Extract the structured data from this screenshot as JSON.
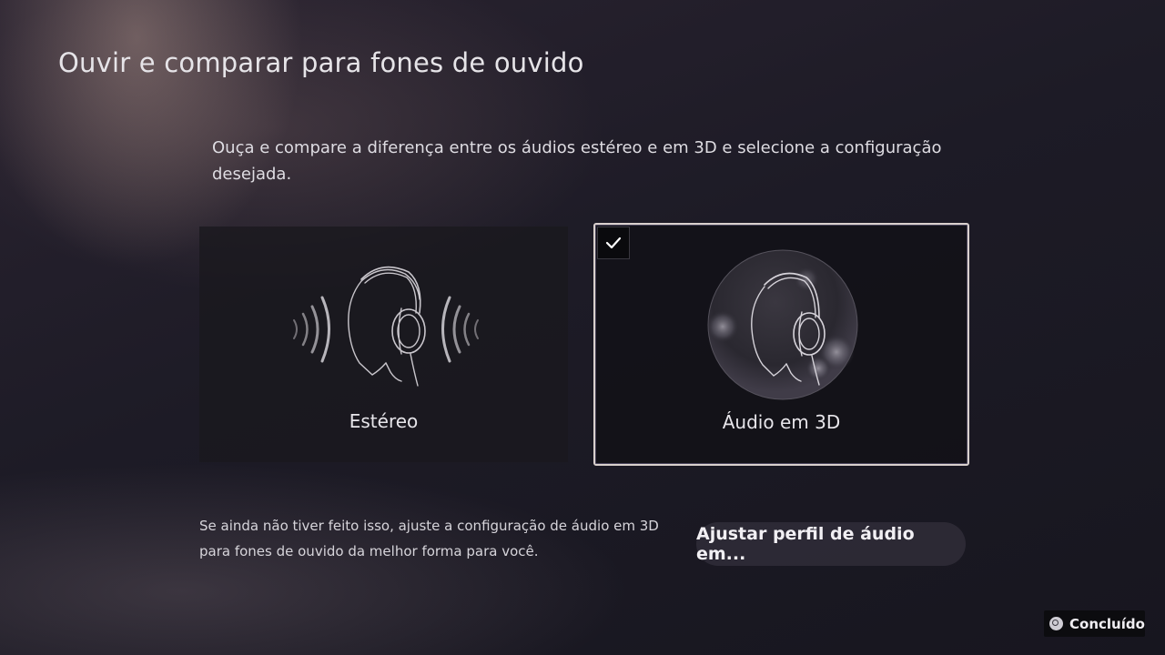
{
  "page": {
    "title": "Ouvir e comparar para fones de ouvido",
    "description": "Ouça e compare a diferença entre os áudios estéreo e em 3D e selecione a configuração desejada."
  },
  "options": [
    {
      "label": "Estéreo",
      "selected": false,
      "icon": "stereo-headphones-icon"
    },
    {
      "label": "Áudio em 3D",
      "selected": true,
      "icon": "3d-audio-headphones-icon"
    }
  ],
  "hint": {
    "line1": "Se ainda não tiver feito isso, ajuste a configuração de áudio em 3D",
    "line2": "para fones de ouvido da melhor forma para você."
  },
  "adjust_button": {
    "label": "Ajustar perfil de áudio em..."
  },
  "footer": {
    "done_label": "Concluído",
    "done_icon": "circle-button-icon"
  },
  "colors": {
    "selection_border": "#d9d0cd",
    "background": "#1d1b26"
  }
}
